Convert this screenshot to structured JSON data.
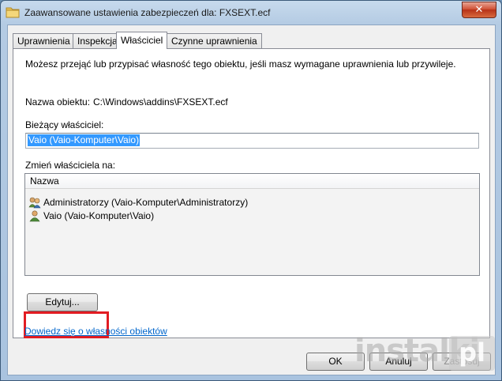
{
  "window": {
    "title": "Zaawansowane ustawienia zabezpieczeń dla: FXSEXT.ecf",
    "close_glyph": "✕"
  },
  "tabs": [
    {
      "label": "Uprawnienia"
    },
    {
      "label": "Inspekcja"
    },
    {
      "label": "Właściciel",
      "active": true
    },
    {
      "label": "Czynne uprawnienia"
    }
  ],
  "owner_tab": {
    "description": "Możesz przejąć lub przypisać własność tego obiektu, jeśli masz wymagane uprawnienia lub przywileje.",
    "object_name_label": "Nazwa obiektu:",
    "object_name_value": "C:\\Windows\\addins\\FXSEXT.ecf",
    "current_owner_label": "Bieżący właściciel:",
    "current_owner_value": "Vaio (Vaio-Komputer\\Vaio)",
    "change_owner_label": "Zmień właściciela na:",
    "list_header": "Nazwa",
    "list_items": [
      {
        "label": "Administratorzy (Vaio-Komputer\\Administratorzy)",
        "icon": "users-group-icon"
      },
      {
        "label": "Vaio (Vaio-Komputer\\Vaio)",
        "icon": "user-icon"
      }
    ],
    "edit_button": "Edytuj...",
    "link": "Dowiedz się o własności obiektów"
  },
  "footer": {
    "ok": "OK",
    "cancel": "Anuluj",
    "apply": "Zastosuj"
  },
  "watermark": {
    "text": "instalki",
    "suffix": "pl"
  },
  "colors": {
    "accent_red": "#e21c22",
    "selection": "#3399ff",
    "link": "#0066cc"
  }
}
